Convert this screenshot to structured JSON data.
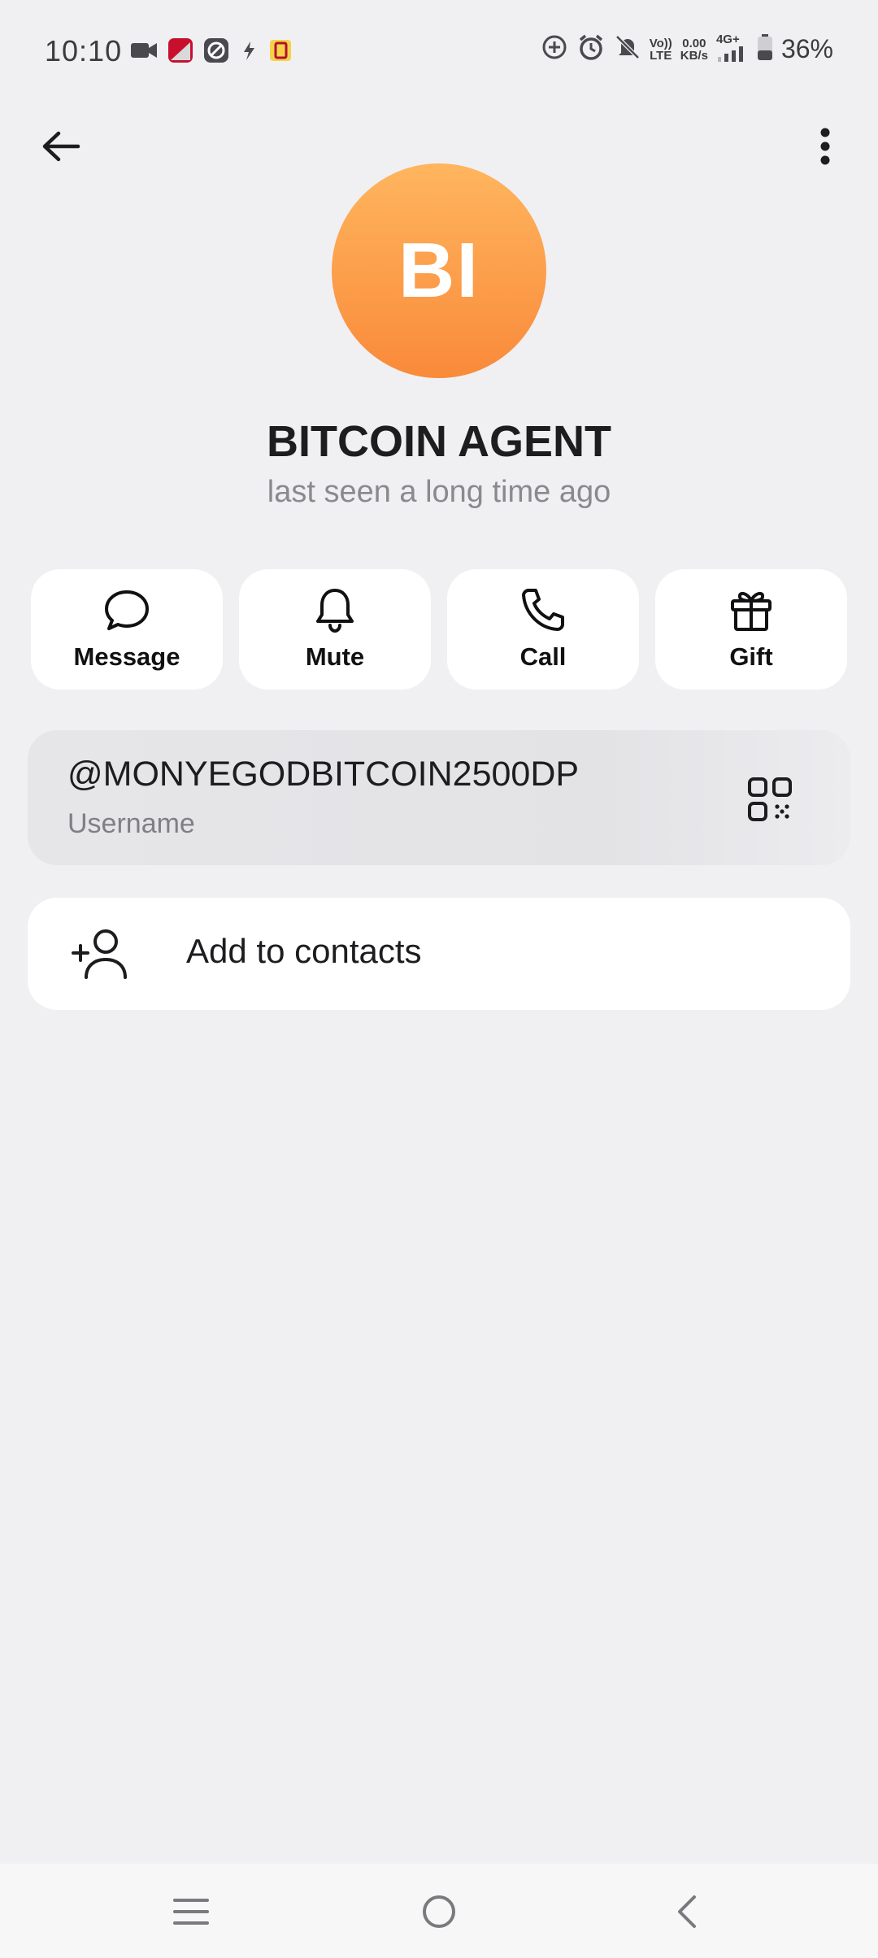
{
  "status_bar": {
    "time": "10:10",
    "data_rate_value": "0.00",
    "data_rate_unit": "KB/s",
    "volte_top": "Vo))",
    "volte_bottom": "LTE",
    "network": "4G+",
    "battery": "36%"
  },
  "profile": {
    "initials": "BI",
    "name": "BITCOIN AGENT",
    "last_seen": "last seen a long time ago",
    "avatar_colors": [
      "#ffb55e",
      "#f98a3a"
    ]
  },
  "actions": [
    {
      "label": "Message",
      "icon": "chat-bubble-icon"
    },
    {
      "label": "Mute",
      "icon": "bell-icon"
    },
    {
      "label": "Call",
      "icon": "phone-icon"
    },
    {
      "label": "Gift",
      "icon": "gift-icon"
    }
  ],
  "username": {
    "value": "@MONYEGODBITCOIN2500DP",
    "label": "Username",
    "icon": "qr-code-icon"
  },
  "add_contact": {
    "label": "Add to contacts",
    "icon": "add-person-icon"
  },
  "navigation": {
    "icons": [
      "menu-icon",
      "home-icon",
      "back-icon"
    ]
  }
}
